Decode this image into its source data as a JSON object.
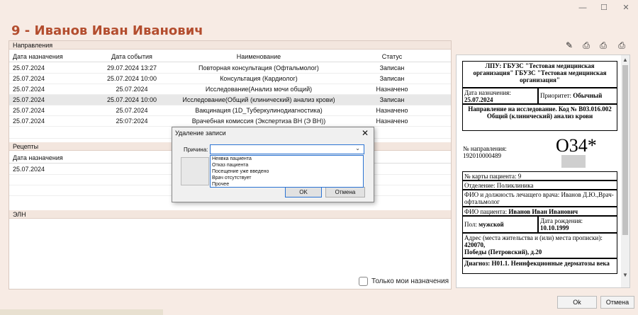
{
  "header": {
    "title": "9 - Иванов Иван Иванович"
  },
  "directions": {
    "section_title": "Направления",
    "columns": [
      "Дата назначения",
      "Дата события",
      "Наименование",
      "Статус"
    ],
    "rows": [
      [
        "25.07.2024",
        "29.07.2024 13:27",
        "Повторная консультация (Офтальмолог)",
        "Записан"
      ],
      [
        "25.07.2024",
        "25.07.2024 10:00",
        "Консультация (Кардиолог)",
        "Записан"
      ],
      [
        "25.07.2024",
        "25.07.2024",
        "Исследование(Анализ мочи общий)",
        "Назначено"
      ],
      [
        "25.07.2024",
        "25.07.2024 10:00",
        "Исследование(Общий (клинический) анализ крови)",
        "Записан"
      ],
      [
        "25.07.2024",
        "25.07.2024",
        "Вакцинация (1D_Туберкулинодиагностика)",
        "Назначено"
      ],
      [
        "25.07.2024",
        "25:07:2024",
        "Врачебная комиссия (Экспертиза ВН (Э ВН))",
        "Назначено"
      ]
    ]
  },
  "recipes": {
    "section_title": "Рецепты",
    "column": "Дата назначения",
    "rows": [
      "25.07.2024"
    ]
  },
  "eln": {
    "section_title": "ЭЛН"
  },
  "only_mine_label": "Только мои назначения",
  "document": {
    "lpu": "ЛПУ: ГБУЗС \"Тестовая медицинская организация\" ГБУЗС \"Тестовая медицинская организация\"",
    "date_label": "Дата назначения:",
    "date_value": "25.07.2024",
    "priority_label": "Приоритет:",
    "priority_value": "Обычный",
    "direction_title": "Направление на исследование. Код № B03.016.002 Общий (клинический) анализ крови",
    "direction_no_label": "№ направления:",
    "direction_no_value": "192010000489",
    "big_code": "O34*",
    "card_no": "№ карты пациента: 9",
    "department": "Отделение: Поликлиника",
    "doctor": "ФИО и должность лечащего врача: Иванов Д.Ю.,Врач-офтальмолог",
    "patient_label": "ФИО пациента:",
    "patient_value": "Иванов Иван Иванович",
    "sex_label": "Пол:",
    "sex_value": "мужской",
    "birth_label": "Дата рождения:",
    "birth_value": "10.10.1999",
    "address_label": "Адрес (места жительства и (или) места прописки):",
    "address_line1": "420070,",
    "address_line2": "Победы (Петровский), д.20",
    "diagnosis": "Диагноз: H01.1. Неинфекционные дерматозы века"
  },
  "dialog": {
    "title": "Удаление записи",
    "reason_label": "Причина:",
    "options": [
      "Неявка пациента",
      "Отказ пациента",
      "Посещение уже введено",
      "Врач отсутствует",
      "Прочее"
    ],
    "ok": "OK",
    "cancel": "Отмена"
  },
  "footer": {
    "ok": "Ok",
    "cancel": "Отмена"
  }
}
